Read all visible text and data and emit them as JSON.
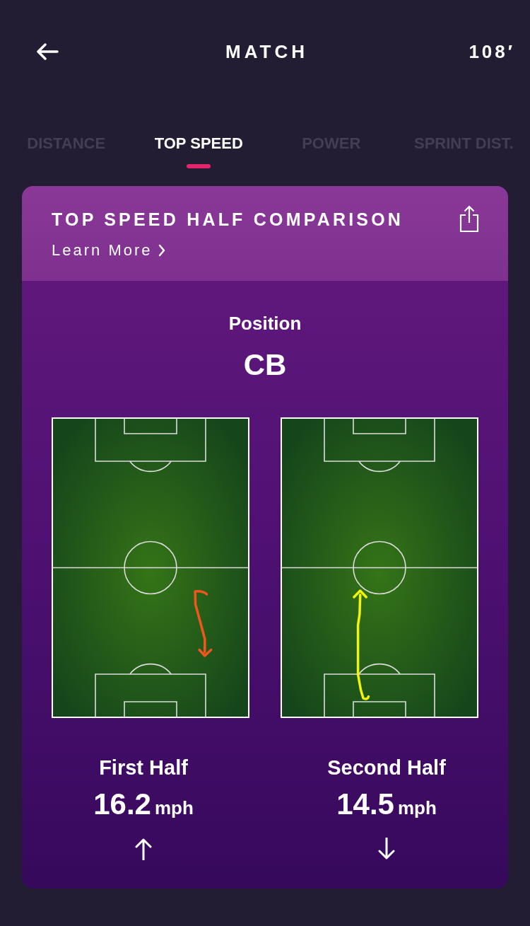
{
  "header": {
    "title": "MATCH",
    "match_minute": "108′"
  },
  "tabs": [
    {
      "label": "DISTANCE",
      "selected": false
    },
    {
      "label": "TOP SPEED",
      "selected": true
    },
    {
      "label": "POWER",
      "selected": false
    },
    {
      "label": "SPRINT DIST.",
      "selected": false
    }
  ],
  "card": {
    "title": "TOP SPEED HALF COMPARISON",
    "link": "Learn More",
    "position_label": "Position",
    "position": "CB",
    "halves": [
      {
        "label": "First Half",
        "value": "16.2",
        "unit": "mph",
        "kind": "up",
        "color": "#f0561e"
      },
      {
        "label": "Second Half",
        "value": "14.5",
        "unit": "mph",
        "kind": "down",
        "color": "#f2f50a"
      }
    ]
  }
}
